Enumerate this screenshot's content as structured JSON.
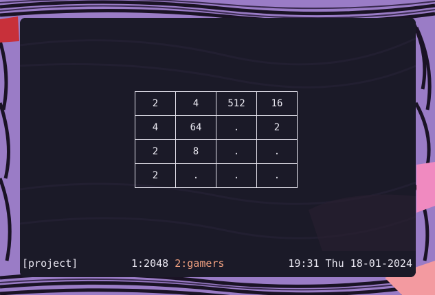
{
  "theme": {
    "wallpaper_base": "#8b6cb8",
    "wallpaper_stripe": "#1a1325",
    "terminal_bg": "#1b1a28",
    "accent": "#f0a080",
    "text": "#ecebf3"
  },
  "game": {
    "board": [
      [
        "2",
        "4",
        "512",
        "16"
      ],
      [
        "4",
        "64",
        ".",
        "2"
      ],
      [
        "2",
        "8",
        ".",
        "."
      ],
      [
        "2",
        ".",
        ".",
        "."
      ]
    ]
  },
  "statusbar": {
    "session": "[project]",
    "window_1": "1:2048",
    "window_2": "2:gamers",
    "clock": "19:31 Thu 18-01-2024"
  }
}
